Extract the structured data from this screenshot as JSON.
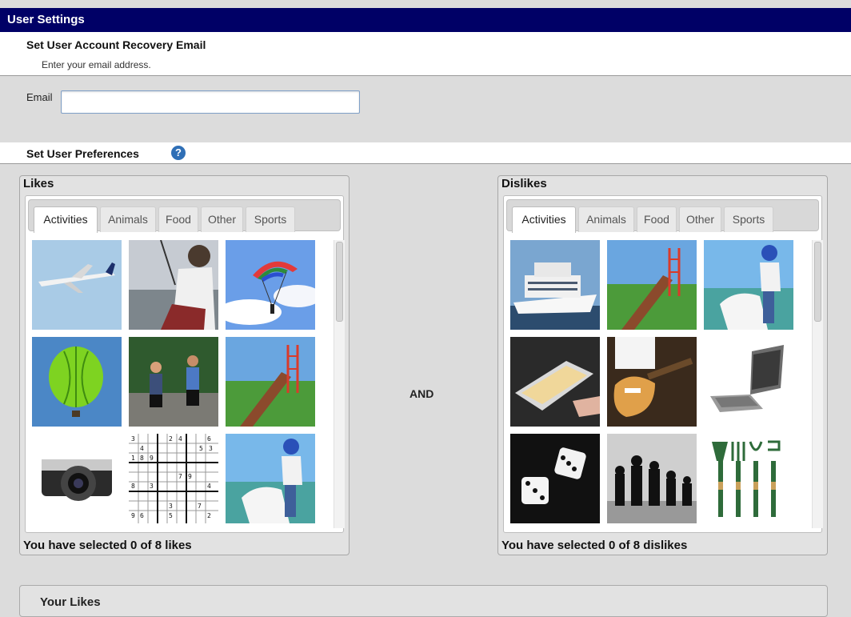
{
  "header": {
    "title": "User Settings"
  },
  "recovery": {
    "heading": "Set User Account Recovery Email",
    "instruction": "Enter your email address.",
    "email_label": "Email",
    "email_value": ""
  },
  "preferences": {
    "heading": "Set User Preferences",
    "help_icon": "help-icon"
  },
  "likes": {
    "title": "Likes",
    "tabs": [
      "Activities",
      "Animals",
      "Food",
      "Other",
      "Sports"
    ],
    "active_tab": "Activities",
    "count_text": "You have selected 0 of 8 likes",
    "images": [
      "airplane",
      "fishing",
      "skydiving",
      "hot-air-balloon",
      "running",
      "slide",
      "camera",
      "sudoku",
      "horse-riding"
    ]
  },
  "and_label": "AND",
  "dislikes": {
    "title": "Dislikes",
    "tabs": [
      "Activities",
      "Animals",
      "Food",
      "Other",
      "Sports"
    ],
    "active_tab": "Activities",
    "count_text": "You have selected 0 of 8 dislikes",
    "images": [
      "cruise-ship",
      "slide",
      "horse-riding",
      "baking",
      "guitar",
      "laptop",
      "dice",
      "chess",
      "garden-tools"
    ]
  },
  "your_likes": {
    "heading": "Your Likes"
  },
  "colors": {
    "header_bg": "#000066",
    "help_icon": "#2f6fb6",
    "accent_input_border": "#7fa0c8"
  }
}
